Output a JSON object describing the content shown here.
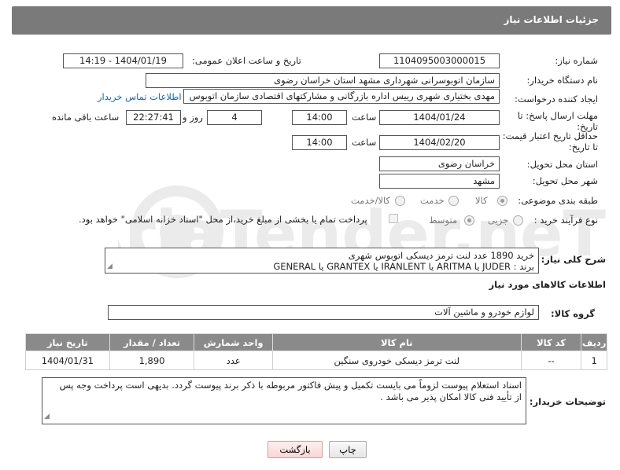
{
  "header": {
    "title": "جزئیات اطلاعات نیاز"
  },
  "form": {
    "need_number_label": "شماره نیاز:",
    "need_number": "1104095003000015",
    "announce_label": "تاریخ و ساعت اعلان عمومی:",
    "announce_value": "1404/01/19 - 14:19",
    "buyer_org_label": "نام دستگاه خریدار:",
    "buyer_org": "سازمان اتوبوسرانی شهرداری مشهد استان خراسان رضوی",
    "creator_label": "ایجاد کننده درخواست:",
    "creator": "مهدی بختیاری شهری رییس اداره بازرگانی و مشارکتهای اقتصادی سازمان اتوبوس",
    "contact_link": "اطلاعات تماس خریدار",
    "deadline_label_1": "مهلت ارسال پاسخ: تا",
    "deadline_label_2": "تاریخ:",
    "deadline_date": "1404/01/24",
    "time_label": "ساعت",
    "deadline_time": "14:00",
    "days_value": "4",
    "days_label": "روز و",
    "remaining_time": "22:27:41",
    "remaining_label": "ساعت باقی مانده",
    "min_valid_label_1": "حداقل تاریخ اعتبار قیمت:",
    "min_valid_label_2": "تا تاریخ:",
    "min_valid_date": "1404/02/20",
    "min_valid_time": "14:00",
    "province_label": "استان محل تحویل:",
    "province": "خراسان رضوی",
    "city_label": "شهر محل تحویل:",
    "city": "مشهد",
    "category_label": "طبقه بندی موضوعی:",
    "category_options": [
      "کالا",
      "خدمت",
      "کالا/خدمت"
    ],
    "process_label": "نوع فرآیند خرید :",
    "process_options": [
      "جزیی",
      "متوسط"
    ],
    "payment_note": "پرداخت تمام یا بخشی از مبلغ خرید،از محل \"اسناد خزانه اسلامی\" خواهد بود."
  },
  "description": {
    "label": "شرح کلی نیاز:",
    "line1": "خرید 1890 عدد لنت ترمز دیسکی اتوبوس شهری",
    "line2": "برند : JUDER یا ARITMA یا IRANLENT یا GRANTEX یا GENERAL"
  },
  "goods": {
    "section_title": "اطلاعات کالاهای مورد نیاز",
    "group_label": "گروه کالا:",
    "group_value": "لوازم خودرو و ماشین آلات",
    "columns": [
      "ردیف",
      "کد کالا",
      "نام کالا",
      "واحد شمارش",
      "تعداد / مقدار",
      "تاریخ نیاز"
    ],
    "rows": [
      {
        "row": "1",
        "code": "--",
        "name": "لنت ترمز دیسکی خودروی سنگین",
        "unit": "عدد",
        "qty": "1,890",
        "date": "1404/01/31"
      }
    ]
  },
  "buyer_notes": {
    "label": "توضیحات خریدار:",
    "line1": "اسناد استعلام پیوست لزوماً می بایست تکمیل و پیش فاکتور مربوطه با ذکر برند پیوست گردد. بدیهی است پرداخت وجه پس",
    "line2": "از تأیید فنی کالا امکان پذیر می باشد ."
  },
  "buttons": {
    "print": "چاپ",
    "back": "بازگشت"
  },
  "watermark_text": "AriaTender.neT",
  "colors": {
    "header": "#7a7a7a",
    "table_header": "#8a8a8a",
    "link": "#1a63b8"
  }
}
